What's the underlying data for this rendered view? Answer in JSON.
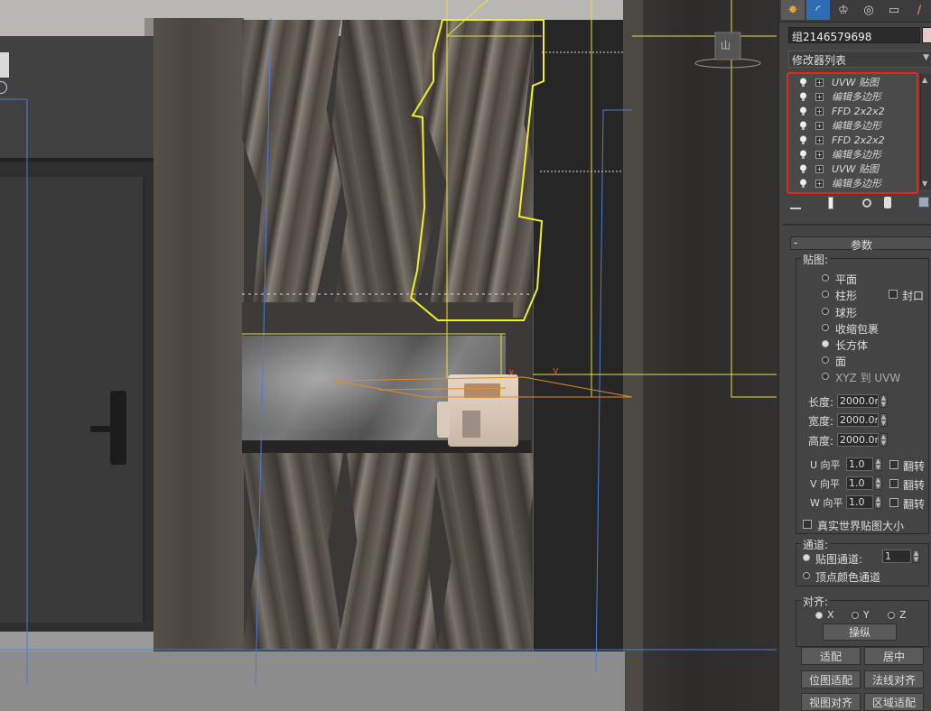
{
  "tabs": [
    {
      "name": "create-tab",
      "icon": "sun-icon",
      "glyph": "✸"
    },
    {
      "name": "modify-tab",
      "icon": "bend-icon",
      "glyph": "◜"
    },
    {
      "name": "hierarchy-tab",
      "icon": "hierarchy-icon",
      "glyph": "♔"
    },
    {
      "name": "motion-tab",
      "icon": "motion-icon",
      "glyph": "◎"
    },
    {
      "name": "display-tab",
      "icon": "display-icon",
      "glyph": "▭"
    },
    {
      "name": "utilities-tab",
      "icon": "hammer-icon",
      "glyph": "∕"
    }
  ],
  "object": {
    "name": "组2146579698",
    "color": "#e8c8c8"
  },
  "modifier_list": {
    "label": "修改器列表",
    "arrow": "▼"
  },
  "stack": [
    "UVW 贴图",
    "编辑多边形",
    "FFD 2x2x2",
    "编辑多边形",
    "FFD 2x2x2",
    "编辑多边形",
    "UVW 贴图",
    "编辑多边形"
  ],
  "stack_scroll": {
    "up": "▲",
    "down": "▼"
  },
  "stack_tools": [
    "pin-stack-icon",
    "show-end-result-icon",
    "make-unique-icon",
    "remove-modifier-icon",
    "configure-modifier-sets-icon"
  ],
  "rollout": {
    "toggle": "-",
    "title": "参数"
  },
  "mapping": {
    "group_label": "贴图:",
    "options": [
      "平面",
      "柱形",
      "球形",
      "收缩包裹",
      "长方体",
      "面",
      "XYZ 到 UVW"
    ],
    "selected_index": 4,
    "cap_label": "封口"
  },
  "dims": [
    {
      "label": "长度:",
      "value": "2000.0m"
    },
    {
      "label": "宽度:",
      "value": "2000.0m"
    },
    {
      "label": "高度:",
      "value": "2000.0m"
    }
  ],
  "tiles": [
    {
      "label": "U 向平",
      "value": "1.0",
      "flip": "翻转"
    },
    {
      "label": "V 向平",
      "value": "1.0",
      "flip": "翻转"
    },
    {
      "label": "W 向平",
      "value": "1.0",
      "flip": "翻转"
    }
  ],
  "real_world_label": "真实世界贴图大小",
  "channel": {
    "group_label": "通道:",
    "map_channel_label": "贴图通道:",
    "map_channel_value": "1",
    "vertex_color_label": "顶点颜色通道"
  },
  "alignment": {
    "group_label": "对齐:",
    "axes": [
      "X",
      "Y",
      "Z"
    ],
    "selected_axis": 0,
    "manipulate_label": "操纵",
    "buttons": [
      "适配",
      "居中",
      "位图适配",
      "法线对齐",
      "视图对齐",
      "区域适配"
    ]
  },
  "viewport": {
    "axis_labels": [
      "x",
      "y"
    ],
    "gizmo_label": "山",
    "spinner_up": "▲",
    "spinner_down": "▼"
  }
}
